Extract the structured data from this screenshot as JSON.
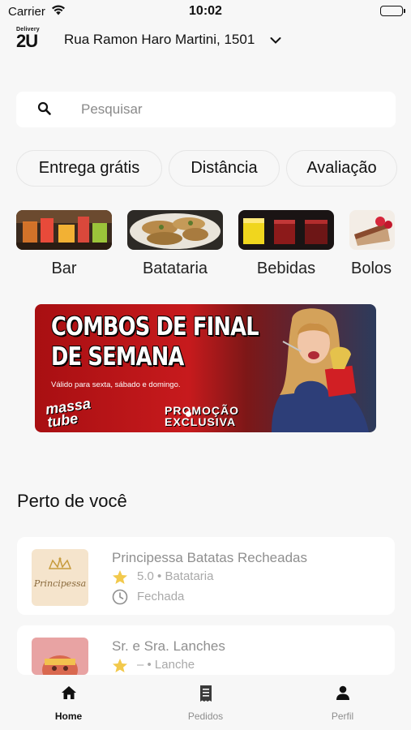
{
  "status_bar": {
    "carrier": "Carrier",
    "time": "10:02"
  },
  "header": {
    "logo_small": "Delivery",
    "logo_big": "2U",
    "address": "Rua Ramon Haro Martini, 1501"
  },
  "search": {
    "placeholder": "Pesquisar"
  },
  "filters": [
    {
      "label": "Entrega grátis"
    },
    {
      "label": "Distância"
    },
    {
      "label": "Avaliação"
    }
  ],
  "categories": [
    {
      "label": "Bar"
    },
    {
      "label": "Batataria"
    },
    {
      "label": "Bebidas"
    },
    {
      "label": "Bolos"
    }
  ],
  "banner": {
    "headline_line1": "COMBOS DE FINAL",
    "headline_line2": "DE SEMANA",
    "subtitle": "Válido para sexta, sábado e domingo.",
    "brand_line1": "massa",
    "brand_line2": "tube",
    "promo_line1": "PROMOÇÃO",
    "promo_line2": "EXCLUSIVA"
  },
  "nearby": {
    "title": "Perto de você",
    "restaurants": [
      {
        "name": "Principessa Batatas Recheadas",
        "rating": "5.0",
        "category": "Batataria",
        "meta": "5.0 • Batataria",
        "status": "Fechada",
        "logo_text": "Principessa"
      },
      {
        "name": "Sr. e Sra. Lanches",
        "rating": "–",
        "category": "Lanche",
        "meta": "– • Lanche",
        "status": ""
      }
    ]
  },
  "tabbar": {
    "tabs": [
      {
        "label": "Home",
        "icon": "home-icon",
        "active": true
      },
      {
        "label": "Pedidos",
        "icon": "receipt-icon",
        "active": false
      },
      {
        "label": "Perfil",
        "icon": "person-icon",
        "active": false
      }
    ]
  },
  "colors": {
    "background": "#f7f7f7",
    "card": "#ffffff",
    "text": "#111111",
    "muted": "#a9a9a9",
    "banner_red": "#c71a1d",
    "star": "#f2c94c"
  }
}
